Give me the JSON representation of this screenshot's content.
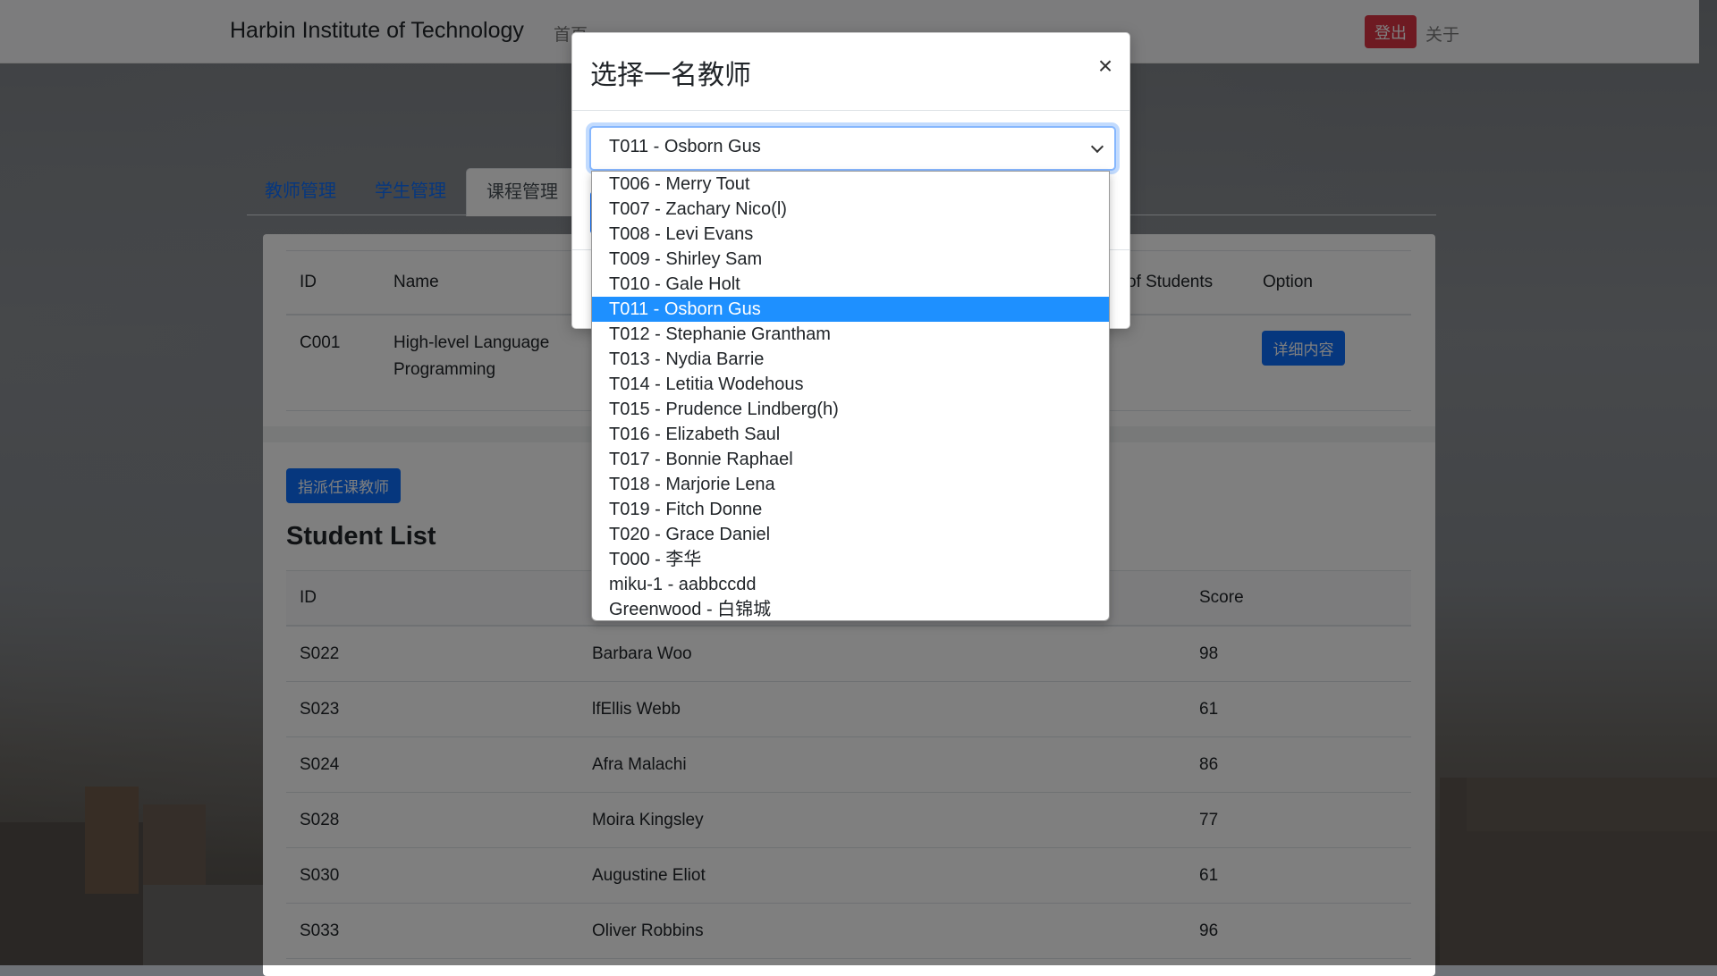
{
  "navbar": {
    "brand": "Harbin Institute of Technology",
    "home": "首页",
    "logout": "登出",
    "about": "关于"
  },
  "tabs": [
    {
      "label": "教师管理"
    },
    {
      "label": "学生管理"
    },
    {
      "label": "课程管理"
    }
  ],
  "course_table": {
    "headers": {
      "id": "ID",
      "name": "Name",
      "num_students": "of Students",
      "option": "Option"
    },
    "rows": [
      {
        "id": "C001",
        "name_line1": "High-level Language",
        "name_line2": "Programming",
        "action": "详细内容"
      }
    ]
  },
  "assign_button": "指派任课教师",
  "student_list": {
    "title": "Student List",
    "headers": {
      "id": "ID",
      "score": "Score"
    },
    "rows": [
      {
        "id": "S022",
        "name": "Barbara Woo",
        "score": "98"
      },
      {
        "id": "S023",
        "name": "lfEllis Webb",
        "score": "61"
      },
      {
        "id": "S024",
        "name": "Afra Malachi",
        "score": "86"
      },
      {
        "id": "S028",
        "name": "Moira Kingsley",
        "score": "77"
      },
      {
        "id": "S030",
        "name": "Augustine Eliot",
        "score": "61"
      },
      {
        "id": "S033",
        "name": "Oliver Robbins",
        "score": "96"
      }
    ]
  },
  "modal": {
    "title": "选择一名教师",
    "close": "×",
    "selected_value": "T011 - Osborn Gus",
    "options": [
      "T006 - Merry Tout",
      "T007 - Zachary Nico(l)",
      "T008 - Levi Evans",
      "T009 - Shirley Sam",
      "T010 - Gale Holt",
      "T011 - Osborn Gus",
      "T012 - Stephanie Grantham",
      "T013 - Nydia Barrie",
      "T014 - Letitia Wodehous",
      "T015 - Prudence Lindberg(h)",
      "T016 - Elizabeth Saul",
      "T017 - Bonnie Raphael",
      "T018 - Marjorie Lena",
      "T019 - Fitch Donne",
      "T020 - Grace Daniel",
      "T000 - 李华",
      "miku-1 - aabbccdd",
      "Greenwood - 白锦城"
    ],
    "selected_index": 5
  },
  "colors": {
    "primary": "#0d6efd",
    "danger": "#dc3545",
    "highlight": "#1e90ff"
  }
}
